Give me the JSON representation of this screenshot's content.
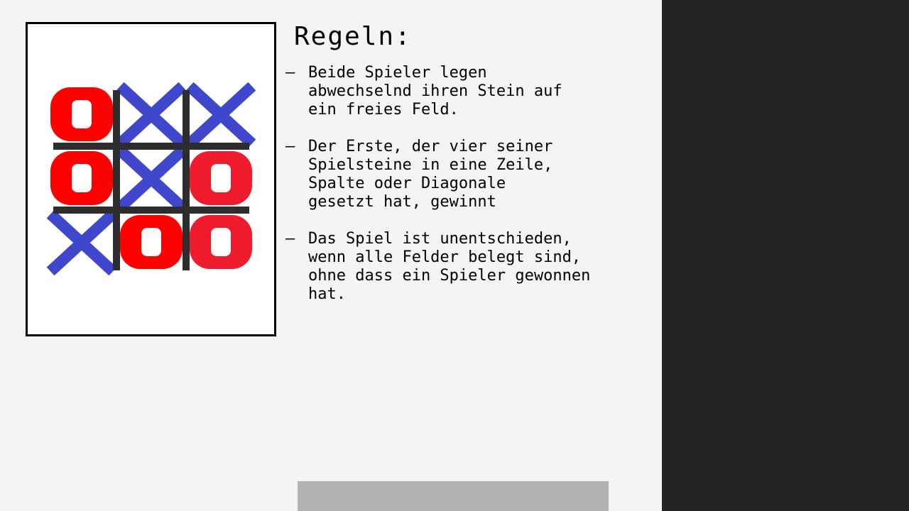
{
  "rules": {
    "title": "Regeln:",
    "bullet": "–",
    "items": [
      {
        "text": "Beide Spieler legen\nabwechselnd ihren Stein auf\nein freies Feld."
      },
      {
        "text": "Der Erste, der vier seiner\nSpielsteine in eine Zeile,\nSpalte oder Diagonale\ngesetzt hat, gewinnt"
      },
      {
        "text": "Das Spiel ist unentschieden,\nwenn alle Felder belegt sind,\nohne dass ein Spieler gewonnen\nhat."
      }
    ]
  },
  "board": {
    "cells": [
      [
        "O",
        "X",
        "X"
      ],
      [
        "O",
        "X",
        "O"
      ],
      [
        "X",
        "O",
        "O"
      ]
    ],
    "colors": {
      "o": "#ff0000",
      "o_alt": "#ee1c2c",
      "x": "#3f48cc",
      "grid": "#2d2d2d",
      "card_bg": "#ffffff",
      "card_border": "#000000"
    }
  },
  "colors": {
    "page_bg": "#f4f4f4",
    "side_panel": "#232323",
    "button": "#b2b2b2"
  },
  "button": {
    "label": ""
  }
}
